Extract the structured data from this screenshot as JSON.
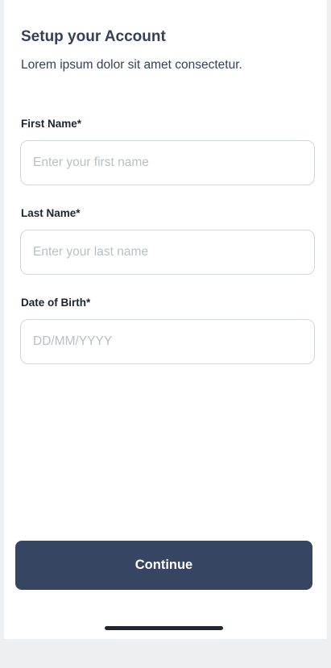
{
  "header": {
    "title": "Setup your Account",
    "subtitle": "Lorem ipsum dolor sit amet consectetur."
  },
  "form": {
    "first_name": {
      "label": "First Name*",
      "placeholder": "Enter your first name",
      "value": ""
    },
    "last_name": {
      "label": "Last Name*",
      "placeholder": "Enter your last name",
      "value": ""
    },
    "date_of_birth": {
      "label": "Date of Birth*",
      "placeholder": "DD/MM/YYYY",
      "value": ""
    }
  },
  "actions": {
    "continue_label": "Continue"
  },
  "colors": {
    "primary": "#364561",
    "heading": "#34415a",
    "border": "#d2d6dd",
    "placeholder": "#b9bec7",
    "background": "#eeeff1"
  }
}
